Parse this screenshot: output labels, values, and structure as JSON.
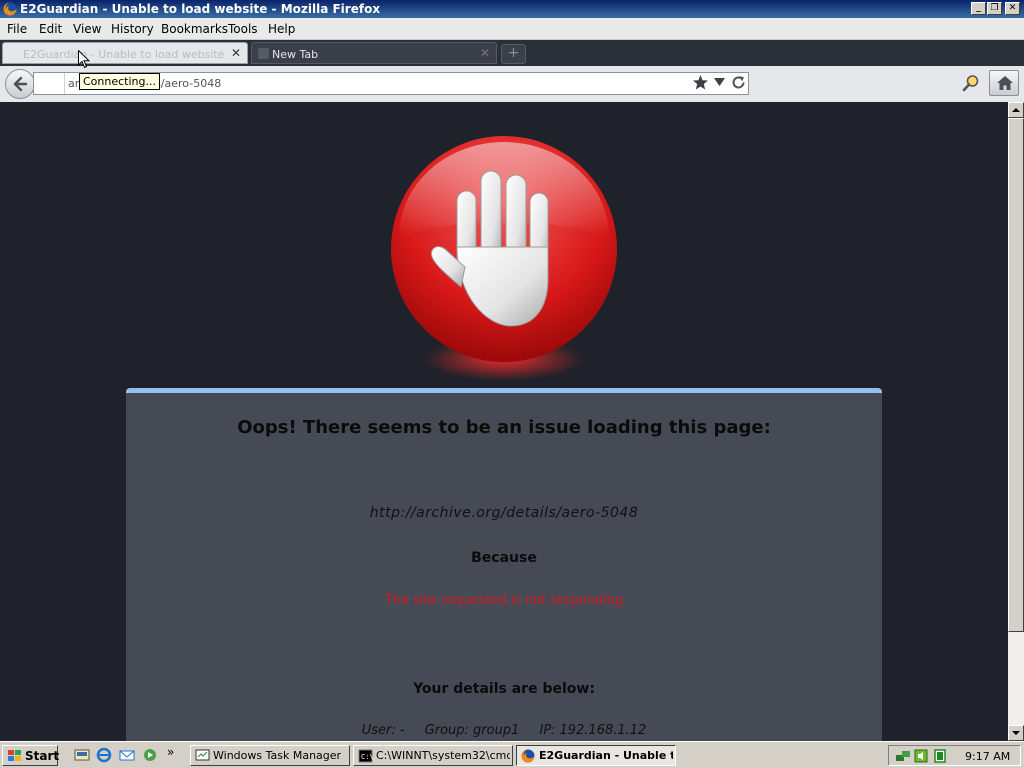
{
  "window": {
    "title": "E2Guardian - Unable to load website - Mozilla Firefox"
  },
  "menu": {
    "items": [
      "File",
      "Edit",
      "View",
      "History",
      "Bookmarks",
      "Tools",
      "Help"
    ]
  },
  "tabs": [
    {
      "label": "E2Guardian - Unable to load website",
      "close": "✕"
    },
    {
      "label": "New Tab",
      "close": "✕"
    }
  ],
  "new_tab_symbol": "+",
  "nav": {
    "url_visible": "arc",
    "url_visible_tail": "s/aero-5048",
    "tooltip": "Connecting..."
  },
  "page": {
    "headline": "Oops! There seems to be an issue loading this page:",
    "blocked_url": "http://archive.org/details/aero-5048",
    "because": "Because",
    "reason": "The site requested is not responding",
    "details_title": "Your details are below:",
    "user": "User: -",
    "group": "Group: group1",
    "ip": "IP: 192.168.1.12"
  },
  "taskbar": {
    "start": "Start",
    "tasks": [
      {
        "label": "Windows Task Manager"
      },
      {
        "label": "C:\\WINNT\\system32\\cmd..."
      },
      {
        "label": "E2Guardian - Unable t..."
      }
    ],
    "more_symbol": "»",
    "clock": "9:17 AM"
  },
  "icons": {
    "firefox": "firefox-icon",
    "back": "back-arrow-icon",
    "star": "star-icon",
    "reload": "reload-icon",
    "google": "google-icon",
    "search": "magnifier-icon",
    "home": "home-icon",
    "stop_hand": "stop-hand-icon"
  },
  "colors": {
    "accent_bar": "#8fc3ec",
    "reason_text": "#cf1c1c",
    "page_bg": "#1f222a",
    "panel_bg": "#464a55"
  }
}
